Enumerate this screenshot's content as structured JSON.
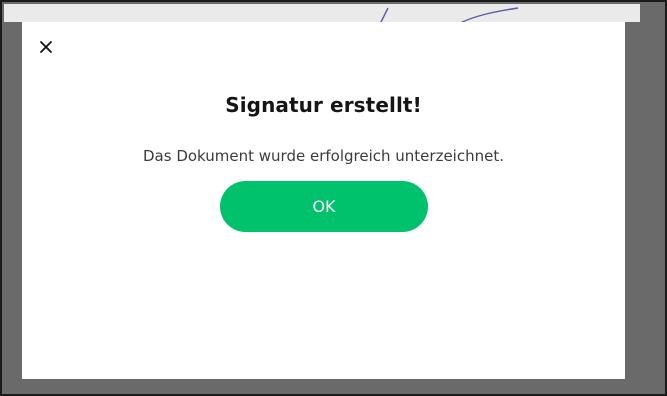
{
  "dialog": {
    "title": "Signatur erstellt!",
    "message": "Das Dokument wurde erfolgreich unterzeichnet.",
    "ok_label": "OK",
    "close_icon": "close-icon"
  },
  "colors": {
    "accent": "#00c26c",
    "overlay": "#6a6a6a",
    "modal_background": "#ffffff",
    "signature_ink": "#5a5aa8"
  }
}
